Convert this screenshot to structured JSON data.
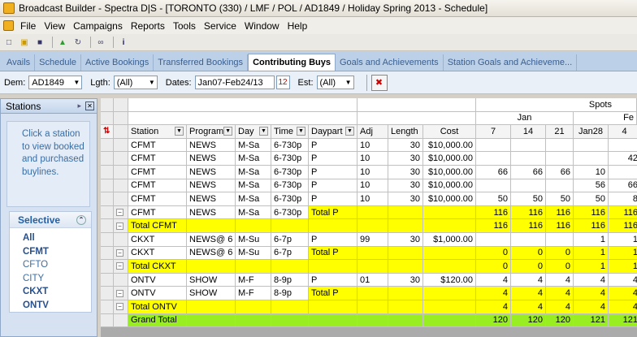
{
  "window": {
    "title": "Broadcast Builder - Spectra D|S - [TORONTO (330) / LMF / POL / AD1849 / Holiday Spring 2013 - Schedule]"
  },
  "menu": [
    "File",
    "View",
    "Campaigns",
    "Reports",
    "Tools",
    "Service",
    "Window",
    "Help"
  ],
  "toolbar_icons": [
    "new-icon",
    "open-icon",
    "save-icon",
    "export-icon",
    "refresh-icon",
    "link-icon",
    "info-icon"
  ],
  "tabs": [
    {
      "label": "Avails",
      "active": false
    },
    {
      "label": "Schedule",
      "active": false
    },
    {
      "label": "Active Bookings",
      "active": false
    },
    {
      "label": "Transferred Bookings",
      "active": false
    },
    {
      "label": "Contributing Buys",
      "active": true
    },
    {
      "label": "Goals and Achievements",
      "active": false
    },
    {
      "label": "Station Goals and Achieveme...",
      "active": false
    }
  ],
  "filters": {
    "dem_label": "Dem:",
    "dem_value": "AD1849",
    "lgth_label": "Lgth:",
    "lgth_value": "(All)",
    "dates_label": "Dates:",
    "dates_value": "Jan07-Feb24/13",
    "est_label": "Est:",
    "est_value": "(All)"
  },
  "stations_panel": {
    "title": "Stations",
    "hint": "Click a station to view booked and purchased buylines.",
    "selective_label": "Selective",
    "items": [
      {
        "label": "All",
        "bold": true
      },
      {
        "label": "CFMT",
        "bold": true
      },
      {
        "label": "CFTO",
        "bold": false
      },
      {
        "label": "CITY",
        "bold": false
      },
      {
        "label": "CKXT",
        "bold": true
      },
      {
        "label": "ONTV",
        "bold": true
      }
    ]
  },
  "grid": {
    "spots_label": "Spots",
    "months": [
      "Jan",
      "Fe"
    ],
    "columns": [
      "Station",
      "Program",
      "Day",
      "Time",
      "Daypart",
      "Adj",
      "Length",
      "Cost",
      "7",
      "14",
      "21",
      "Jan28",
      "4"
    ],
    "rows": [
      {
        "style": "white",
        "expander": "",
        "station": "CFMT",
        "program": "NEWS",
        "day": "M-Sa",
        "time": "6-730p",
        "daypart": "P",
        "adj": "10",
        "length": "30",
        "cost": "$10,000.00",
        "w": [
          "",
          "",
          "",
          "",
          ""
        ]
      },
      {
        "style": "white",
        "expander": "",
        "station": "CFMT",
        "program": "NEWS",
        "day": "M-Sa",
        "time": "6-730p",
        "daypart": "P",
        "adj": "10",
        "length": "30",
        "cost": "$10,000.00",
        "w": [
          "",
          "",
          "",
          "",
          "42"
        ]
      },
      {
        "style": "white",
        "expander": "",
        "station": "CFMT",
        "program": "NEWS",
        "day": "M-Sa",
        "time": "6-730p",
        "daypart": "P",
        "adj": "10",
        "length": "30",
        "cost": "$10,000.00",
        "w": [
          "66",
          "66",
          "66",
          "10",
          ""
        ]
      },
      {
        "style": "white",
        "expander": "",
        "station": "CFMT",
        "program": "NEWS",
        "day": "M-Sa",
        "time": "6-730p",
        "daypart": "P",
        "adj": "10",
        "length": "30",
        "cost": "$10,000.00",
        "w": [
          "",
          "",
          "",
          "56",
          "66"
        ]
      },
      {
        "style": "white",
        "expander": "",
        "station": "CFMT",
        "program": "NEWS",
        "day": "M-Sa",
        "time": "6-730p",
        "daypart": "P",
        "adj": "10",
        "length": "30",
        "cost": "$10,000.00",
        "w": [
          "50",
          "50",
          "50",
          "50",
          "8"
        ]
      },
      {
        "style": "mixed",
        "expander": "⊟",
        "station": "CFMT",
        "program": "NEWS",
        "day": "M-Sa",
        "time": "6-730p",
        "daypart": "Total P",
        "adj": "",
        "length": "",
        "cost": "",
        "w": [
          "116",
          "116",
          "116",
          "116",
          "116"
        ]
      },
      {
        "style": "yellow",
        "expander": "⊟",
        "station": "Total CFMT",
        "program": "",
        "day": "",
        "time": "",
        "daypart": "",
        "adj": "",
        "length": "",
        "cost": "",
        "w": [
          "116",
          "116",
          "116",
          "116",
          "116"
        ]
      },
      {
        "style": "white",
        "expander": "",
        "station": "CKXT",
        "program": "NEWS@ 6",
        "day": "M-Su",
        "time": "6-7p",
        "daypart": "P",
        "adj": "99",
        "length": "30",
        "cost": "$1,000.00",
        "w": [
          "",
          "",
          "",
          "1",
          "1"
        ]
      },
      {
        "style": "mixed",
        "expander": "⊟",
        "station": "CKXT",
        "program": "NEWS@ 6",
        "day": "M-Su",
        "time": "6-7p",
        "daypart": "Total P",
        "adj": "",
        "length": "",
        "cost": "",
        "w": [
          "0",
          "0",
          "0",
          "1",
          "1"
        ]
      },
      {
        "style": "yellow",
        "expander": "⊟",
        "station": "Total CKXT",
        "program": "",
        "day": "",
        "time": "",
        "daypart": "",
        "adj": "",
        "length": "",
        "cost": "",
        "w": [
          "0",
          "0",
          "0",
          "1",
          "1"
        ]
      },
      {
        "style": "white",
        "expander": "",
        "station": "ONTV",
        "program": "SHOW",
        "day": "M-F",
        "time": "8-9p",
        "daypart": "P",
        "adj": "01",
        "length": "30",
        "cost": "$120.00",
        "w": [
          "4",
          "4",
          "4",
          "4",
          "4"
        ]
      },
      {
        "style": "mixed",
        "expander": "⊟",
        "station": "ONTV",
        "program": "SHOW",
        "day": "M-F",
        "time": "8-9p",
        "daypart": "Total P",
        "adj": "",
        "length": "",
        "cost": "",
        "w": [
          "4",
          "4",
          "4",
          "4",
          "4"
        ]
      },
      {
        "style": "yellow",
        "expander": "⊟",
        "station": "Total ONTV",
        "program": "",
        "day": "",
        "time": "",
        "daypart": "",
        "adj": "",
        "length": "",
        "cost": "",
        "w": [
          "4",
          "4",
          "4",
          "4",
          "4"
        ]
      },
      {
        "style": "green",
        "expander": "",
        "station": "Grand Total",
        "program": "",
        "day": "",
        "time": "",
        "daypart": "",
        "adj": "",
        "length": "",
        "cost": "",
        "w": [
          "120",
          "120",
          "120",
          "121",
          "121"
        ]
      }
    ]
  }
}
